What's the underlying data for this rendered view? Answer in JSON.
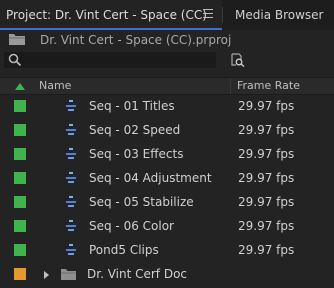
{
  "tabs": {
    "active_label": "Project: Dr. Vint Cert - Space (CC)",
    "inactive_label": "Media Browser"
  },
  "project": {
    "file_name": "Dr. Vint Cert - Space (CC).prproj"
  },
  "search": {
    "value": "",
    "placeholder": ""
  },
  "columns": {
    "name": "Name",
    "frame_rate": "Frame Rate"
  },
  "colors": {
    "sequence_label": "#3fb44a",
    "bin_label": "#e39a2e",
    "sequence_icon": "#4e82d6",
    "active_tab_underline": "#3f6fd0"
  },
  "rows": [
    {
      "type": "sequence",
      "icon": "sequence-icon",
      "label": "Seq - 01 Titles",
      "frame_rate": "29.97 fps"
    },
    {
      "type": "sequence",
      "icon": "sequence-icon",
      "label": "Seq - 02 Speed",
      "frame_rate": "29.97 fps"
    },
    {
      "type": "sequence",
      "icon": "sequence-icon",
      "label": "Seq - 03 Effects",
      "frame_rate": "29.97 fps"
    },
    {
      "type": "sequence",
      "icon": "sequence-icon",
      "label": "Seq - 04 Adjustment",
      "frame_rate": "29.97 fps"
    },
    {
      "type": "sequence",
      "icon": "sequence-icon",
      "label": "Seq - 05 Stabilize",
      "frame_rate": "29.97 fps"
    },
    {
      "type": "sequence",
      "icon": "sequence-icon",
      "label": "Seq - 06 Color",
      "frame_rate": "29.97 fps"
    },
    {
      "type": "sequence",
      "icon": "sequence-icon",
      "label": "Pond5 Clips",
      "frame_rate": "29.97 fps"
    },
    {
      "type": "bin",
      "icon": "folder-icon",
      "label": "Dr. Vint Cerf Doc",
      "frame_rate": ""
    }
  ]
}
